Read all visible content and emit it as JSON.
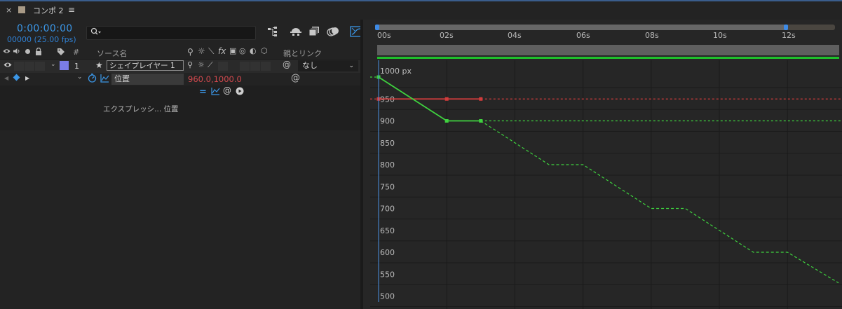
{
  "tab": {
    "close": "×",
    "title": "コンポ 2",
    "menu": "≡"
  },
  "timecode": "0:00:00:00",
  "frame_info": "00000 (25.00 fps)",
  "search": {
    "placeholder": ""
  },
  "columns": {
    "number": "#",
    "source_name": "ソース名",
    "parent": "親とリンク"
  },
  "layer": {
    "number": "1",
    "name": "シェイプレイヤー 1",
    "parent_value": "なし",
    "label_color": "#7b7de6"
  },
  "property": {
    "name": "位置",
    "value_x": "960.0",
    "value_sep": ",",
    "value_y": "1000.0",
    "value_color": "#d3494e"
  },
  "expression": {
    "text": "エクスプレッシ... 位置"
  },
  "ruler": {
    "ticks": [
      "00s",
      "02s",
      "04s",
      "06s",
      "08s",
      "10s",
      "12s"
    ]
  },
  "graph_unit": "1000 px",
  "graph_labels": [
    "950",
    "900",
    "850",
    "800",
    "750",
    "700",
    "650",
    "600",
    "550",
    "500"
  ],
  "colors": {
    "accent": "#3b96e6",
    "x_curve": "#d33c3c",
    "y_curve": "#3fd23f",
    "layer_bar": "#5f5f5f"
  },
  "chart_data": {
    "type": "line",
    "xlabel": "",
    "ylabel": "",
    "ylim": [
      500,
      1000
    ],
    "x_unit": "s",
    "series": [
      {
        "values": [
          [
            0,
            950
          ],
          [
            2,
            950
          ],
          [
            3,
            950
          ]
        ],
        "extrapolated": false
      },
      {
        "values": [
          [
            0,
            1000
          ],
          [
            2,
            900
          ],
          [
            3,
            900
          ]
        ],
        "extrapolated": false
      },
      {
        "values": [
          [
            3,
            900
          ],
          [
            5,
            800
          ],
          [
            6,
            800
          ],
          [
            8,
            700
          ],
          [
            9,
            700
          ],
          [
            11,
            600
          ],
          [
            12,
            600
          ],
          [
            13.5,
            530
          ]
        ],
        "extrapolated": true
      }
    ]
  }
}
